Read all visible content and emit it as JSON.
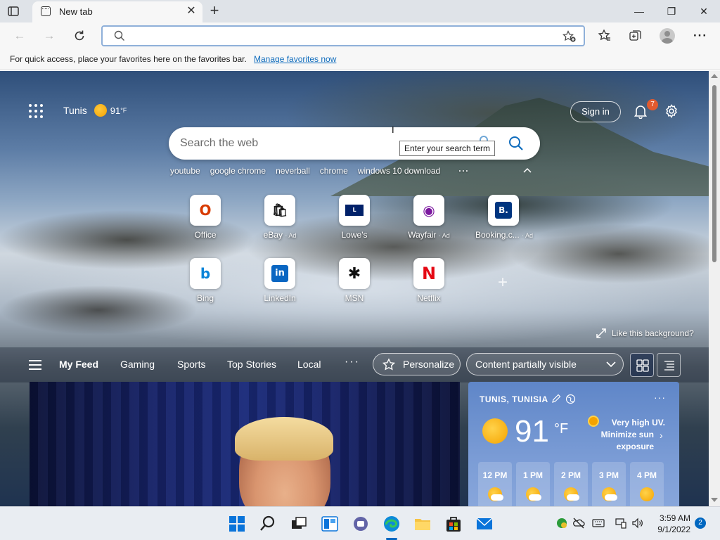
{
  "browser": {
    "tab": {
      "title": "New tab"
    },
    "address": {
      "value": "",
      "placeholder": ""
    },
    "favorites_bar": {
      "message": "For quick access, place your favorites here on the favorites bar.",
      "link": "Manage favorites now"
    }
  },
  "newtab": {
    "weather_mini": {
      "city": "Tunis",
      "temp": "91",
      "unit": "°F"
    },
    "signin_label": "Sign in",
    "notification_count": "7",
    "search": {
      "placeholder": "Search the web",
      "tooltip": "Enter your search term"
    },
    "trending": [
      "youtube",
      "google chrome",
      "neverball",
      "chrome",
      "windows 10 download"
    ],
    "trending_more": "···",
    "quick_links": [
      {
        "label": "Office",
        "ad": "",
        "icon": "office-icon",
        "glyph": "O",
        "color": "#d83b01"
      },
      {
        "label": "eBay",
        "ad": "· Ad",
        "icon": "ebay-icon",
        "glyph": "🛍",
        "color": "#e53238"
      },
      {
        "label": "Lowe's",
        "ad": "",
        "icon": "lowes-icon",
        "glyph": "L",
        "color": "#012169"
      },
      {
        "label": "Wayfair",
        "ad": "· Ad",
        "icon": "wayfair-icon",
        "glyph": "◉",
        "color": "#7b189f"
      },
      {
        "label": "Booking.c...",
        "ad": "· Ad",
        "icon": "booking-icon",
        "glyph": "B.",
        "color": "#003580"
      },
      {
        "label": "Bing",
        "ad": "",
        "icon": "bing-icon",
        "glyph": "b",
        "color": "#0a84d8"
      },
      {
        "label": "LinkedIn",
        "ad": "",
        "icon": "linkedin-icon",
        "glyph": "in",
        "color": "#0a66c2"
      },
      {
        "label": "MSN",
        "ad": "",
        "icon": "msn-icon",
        "glyph": "✱",
        "color": "#111111"
      },
      {
        "label": "Netflix",
        "ad": "",
        "icon": "netflix-icon",
        "glyph": "N",
        "color": "#e50914"
      }
    ],
    "like_background": "Like this background?",
    "feed": {
      "tabs": [
        "My Feed",
        "Gaming",
        "Sports",
        "Top Stories",
        "Local"
      ],
      "more": "···",
      "personalize": "Personalize",
      "visibility": "Content partially visible"
    },
    "weather_card": {
      "location": "TUNIS, TUNISIA",
      "temp": "91",
      "unit": "°F",
      "uv_line1": "Very high UV.",
      "uv_line2": "Minimize sun",
      "uv_line3": "exposure",
      "hours": [
        {
          "time": "12 PM",
          "icon": "partly-cloudy-icon"
        },
        {
          "time": "1 PM",
          "icon": "partly-cloudy-icon"
        },
        {
          "time": "2 PM",
          "icon": "partly-cloudy-icon"
        },
        {
          "time": "3 PM",
          "icon": "partly-cloudy-icon"
        },
        {
          "time": "4 PM",
          "icon": "sunny-icon"
        }
      ]
    }
  },
  "taskbar": {
    "clock_time": "3:59 AM",
    "clock_date": "9/1/2022",
    "notification_count": "2"
  },
  "colors": {
    "accent": "#0067c0",
    "link": "#0f6cbd",
    "badge": "#e15a2f"
  }
}
